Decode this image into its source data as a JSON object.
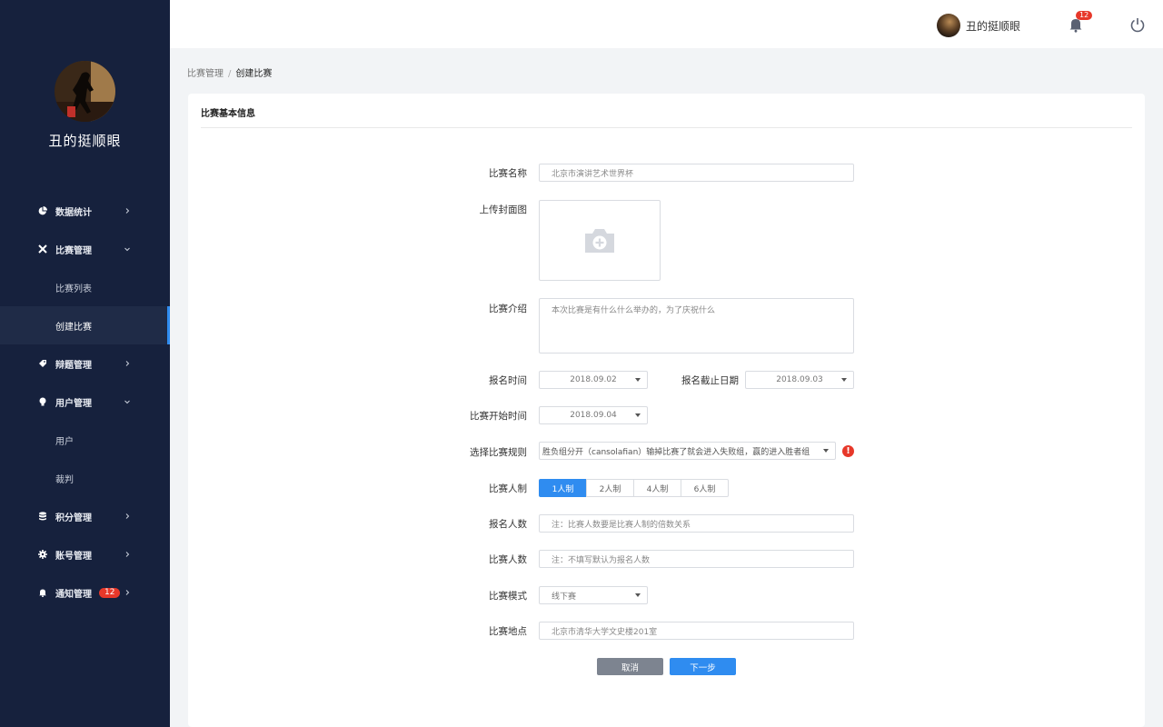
{
  "user": {
    "name": "丑的挺顺眼"
  },
  "sidebar": {
    "items": [
      {
        "label": "数据统计",
        "icon": "pie-chart-icon"
      },
      {
        "label": "比赛管理",
        "icon": "crossed-swords-icon",
        "sub": [
          "比赛列表",
          "创建比赛"
        ]
      },
      {
        "label": "辩题管理",
        "icon": "tag-icon"
      },
      {
        "label": "用户管理",
        "icon": "lightbulb-icon",
        "sub": [
          "用户",
          "裁判"
        ]
      },
      {
        "label": "积分管理",
        "icon": "database-icon"
      },
      {
        "label": "账号管理",
        "icon": "gear-icon"
      },
      {
        "label": "通知管理",
        "icon": "bell-icon",
        "badge": "12"
      }
    ],
    "active_sub": "创建比赛"
  },
  "topbar": {
    "notification_count": "12"
  },
  "breadcrumb": {
    "parent": "比赛管理",
    "separator": "/",
    "current": "创建比赛"
  },
  "card": {
    "title": "比赛基本信息"
  },
  "form": {
    "name_label": "比赛名称",
    "name_value": "北京市演讲艺术世界杯",
    "cover_label": "上传封面图",
    "intro_label": "比赛介绍",
    "intro_value": "本次比赛是有什么什么举办的，为了庆祝什么",
    "signup_time_label": "报名时间",
    "signup_time_value": "2018.09.02",
    "signup_deadline_label": "报名截止日期",
    "signup_deadline_value": "2018.09.03",
    "start_time_label": "比赛开始时间",
    "start_time_value": "2018.09.04",
    "rule_label": "选择比赛规则",
    "rule_value": "胜负组分开（cansolafian）输掉比赛了就会进入失败组，赢的进入胜者组",
    "team_size_label": "比赛人制",
    "team_size_options": [
      "1人制",
      "2人制",
      "4人制",
      "6人制"
    ],
    "team_size_selected": "1人制",
    "signup_count_label": "报名人数",
    "signup_count_placeholder": "注：比赛人数要是比赛人制的倍数关系",
    "player_count_label": "比赛人数",
    "player_count_placeholder": "注：不填写默认为报名人数",
    "mode_label": "比赛模式",
    "mode_value": "线下赛",
    "location_label": "比赛地点",
    "location_value": "北京市清华大学文史楼201室",
    "cancel_label": "取消",
    "next_label": "下一步"
  },
  "colors": {
    "sidebar_bg": "#16213d",
    "primary": "#2f8cf0",
    "danger": "#e7382a"
  }
}
